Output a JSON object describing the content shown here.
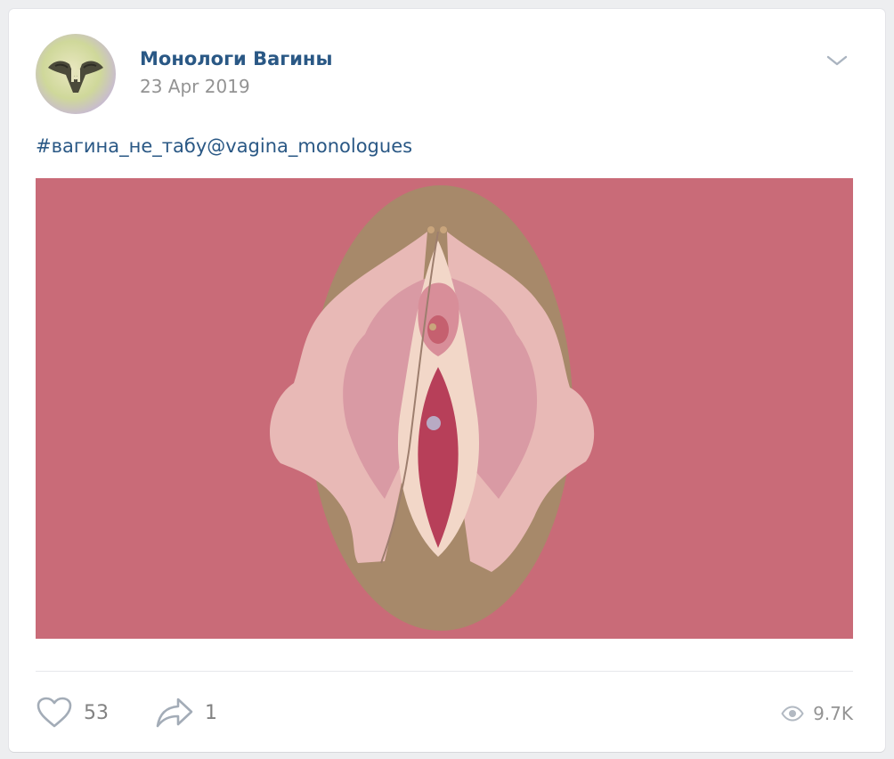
{
  "post": {
    "author": "Монологи Вагины",
    "date": "23 Apr 2019",
    "text": {
      "hashtag": "#вагина_не_табу",
      "mention": "@vagina_monologues"
    },
    "image_icon": "paper-collage-illustration",
    "menu_icon": "chevron-down-icon"
  },
  "footer": {
    "likes": "53",
    "shares": "1",
    "views": "9.7K",
    "like_icon": "heart-icon",
    "share_icon": "share-arrow-icon",
    "views_icon": "eye-icon"
  },
  "colors": {
    "link": "#2a5885",
    "muted": "#939393",
    "icon": "#99a2ad",
    "background": "#edeef0",
    "image_background": "#c96b78"
  }
}
